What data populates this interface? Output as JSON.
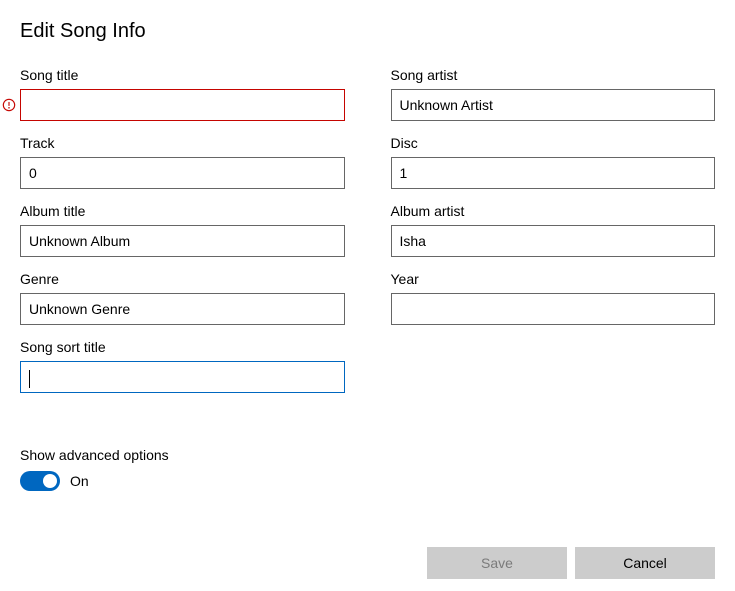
{
  "dialog": {
    "title": "Edit Song Info"
  },
  "fields": {
    "song_title": {
      "label": "Song title",
      "value": ""
    },
    "song_artist": {
      "label": "Song artist",
      "value": "Unknown Artist"
    },
    "track": {
      "label": "Track",
      "value": "0"
    },
    "disc": {
      "label": "Disc",
      "value": "1"
    },
    "album_title": {
      "label": "Album title",
      "value": "Unknown Album"
    },
    "album_artist": {
      "label": "Album artist",
      "value": "Isha"
    },
    "genre": {
      "label": "Genre",
      "value": "Unknown Genre"
    },
    "year": {
      "label": "Year",
      "value": ""
    },
    "song_sort_title": {
      "label": "Song sort title",
      "value": ""
    }
  },
  "advanced": {
    "label": "Show advanced options",
    "state": "On"
  },
  "buttons": {
    "save": "Save",
    "cancel": "Cancel"
  }
}
